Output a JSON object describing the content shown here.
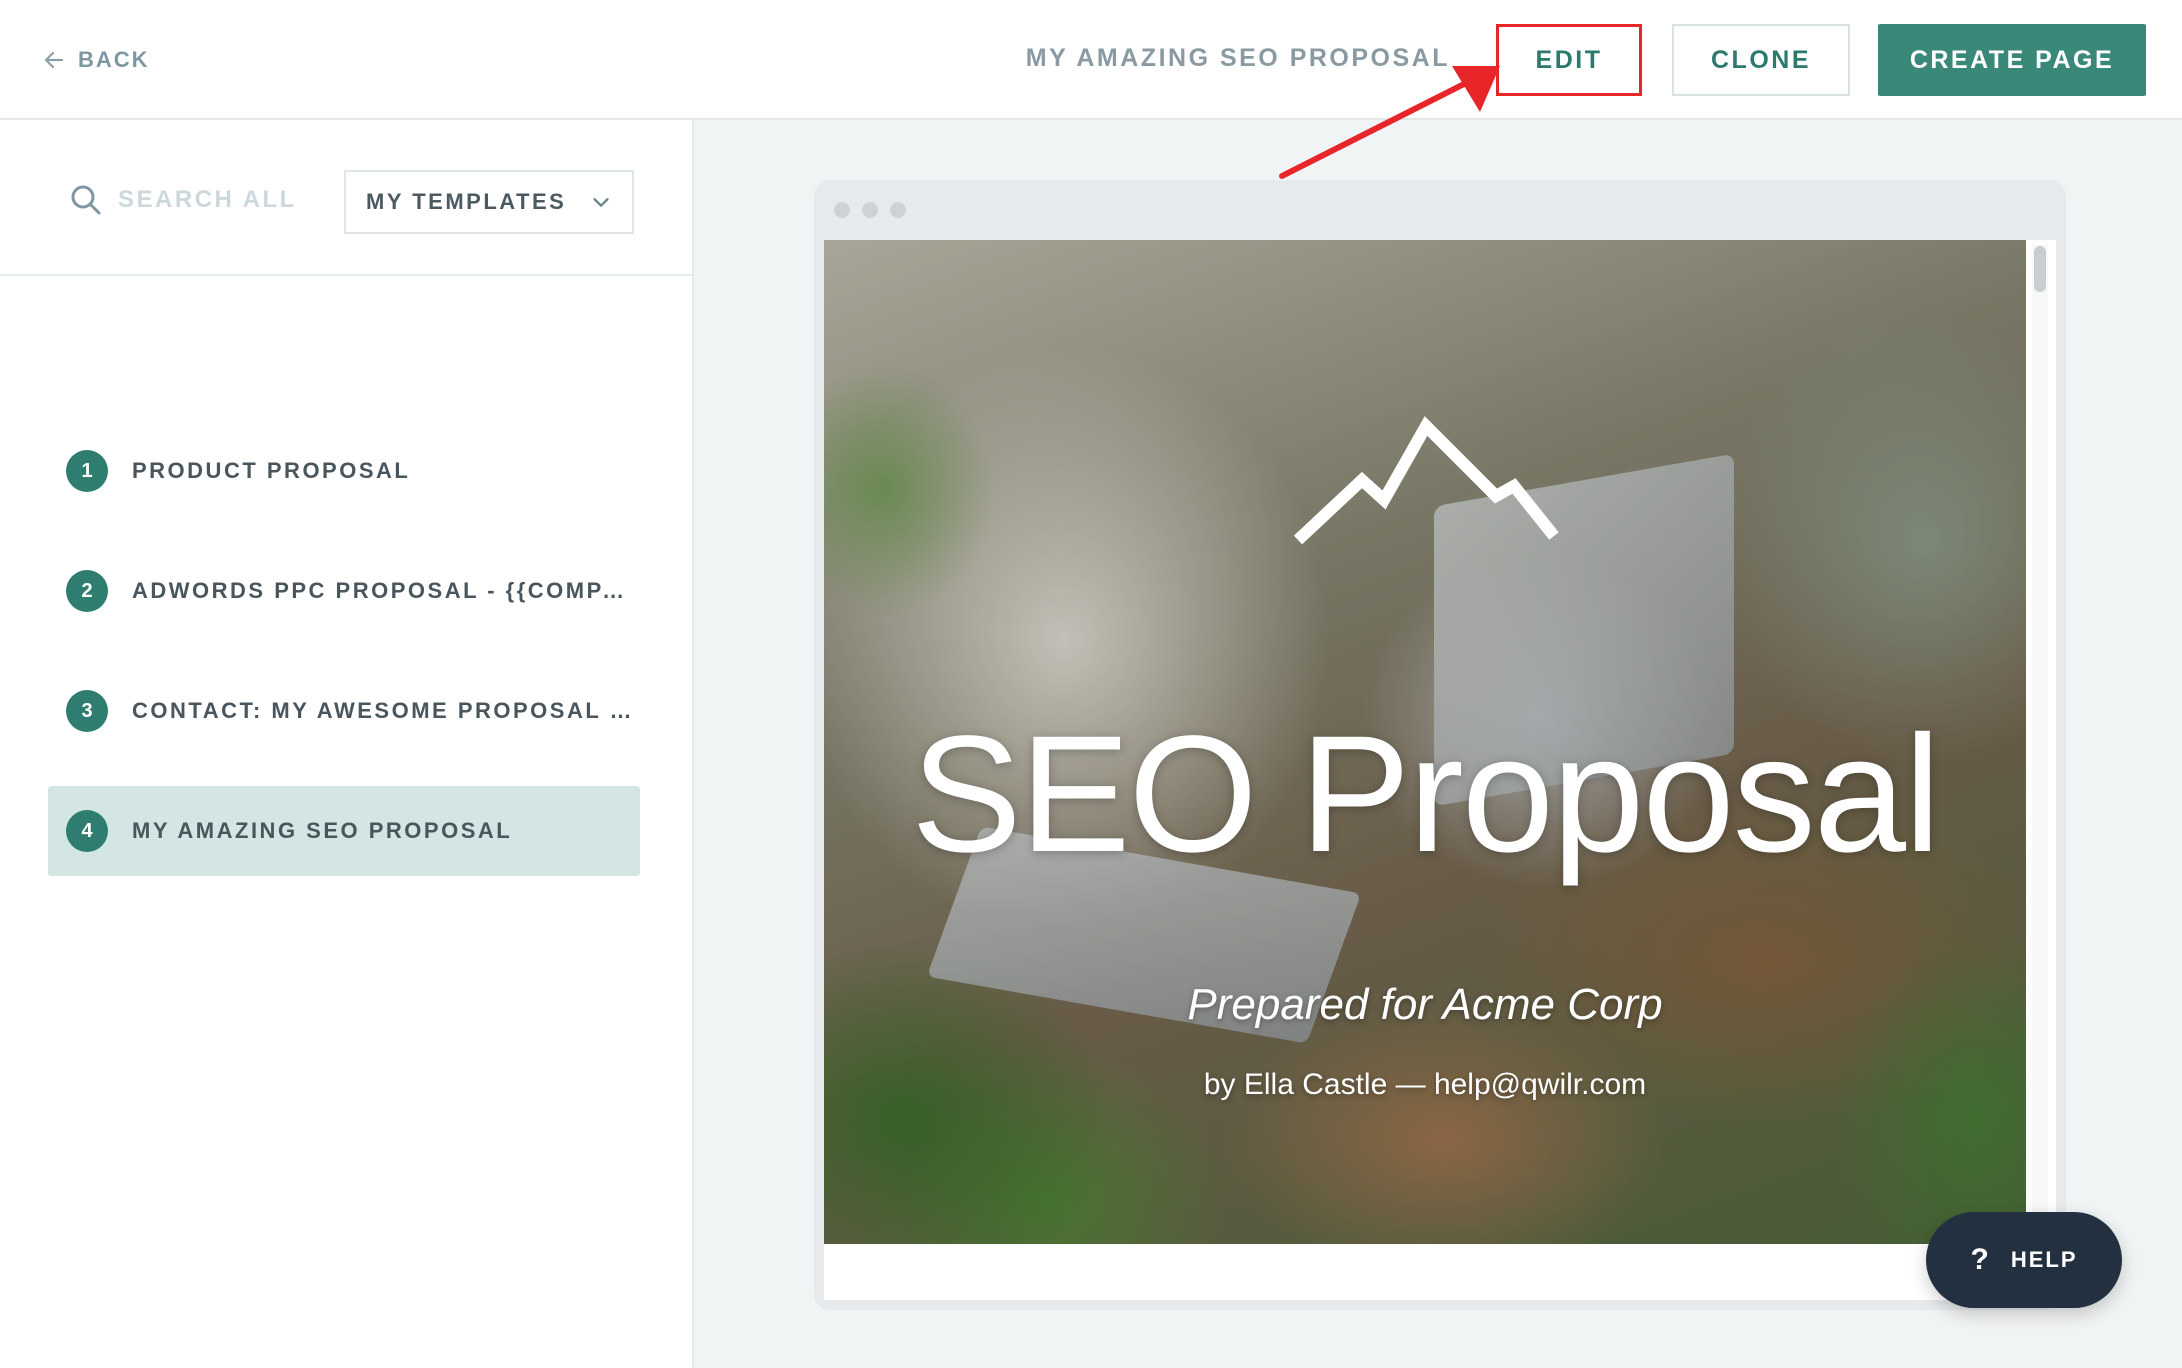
{
  "header": {
    "back_label": "BACK",
    "document_title": "MY AMAZING SEO PROPOSAL",
    "edit_label": "EDIT",
    "clone_label": "CLONE",
    "create_page_label": "CREATE PAGE"
  },
  "sidebar": {
    "search_placeholder": "SEARCH ALL",
    "filter_selected": "MY TEMPLATES",
    "items": [
      {
        "number": "1",
        "label": "PRODUCT PROPOSAL",
        "active": false
      },
      {
        "number": "2",
        "label": "ADWORDS PPC PROPOSAL - {{COMPANYN…",
        "active": false
      },
      {
        "number": "3",
        "label": "CONTACT: MY AWESOME PROPOSAL FOR -…",
        "active": false
      },
      {
        "number": "4",
        "label": "MY AMAZING SEO PROPOSAL",
        "active": true
      }
    ]
  },
  "preview": {
    "hero_title": "SEO Proposal",
    "hero_subtitle": "Prepared for Acme Corp",
    "hero_byline": "by Ella Castle —  help@qwilr.com"
  },
  "help_label": "HELP",
  "colors": {
    "accent": "#3a8879",
    "highlight_box": "#e8262a",
    "active_item_bg": "#d3e6e3",
    "help_bg": "#233040"
  }
}
